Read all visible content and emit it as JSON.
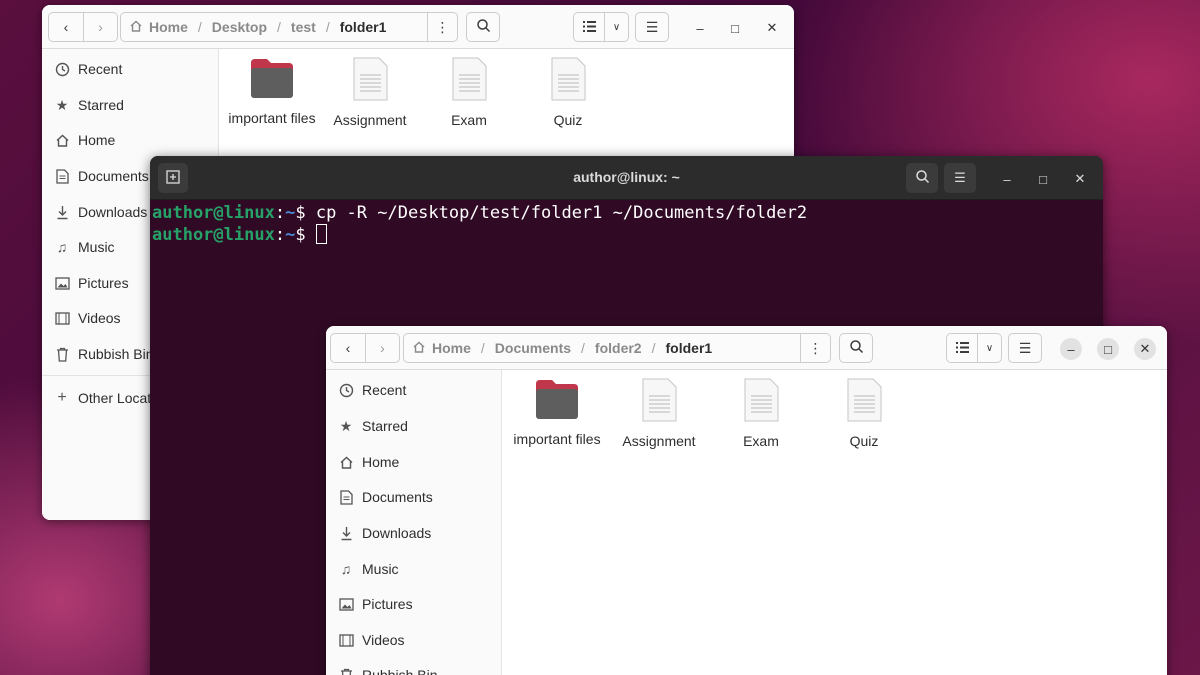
{
  "window1": {
    "path": [
      "Home",
      "Desktop",
      "test",
      "folder1"
    ],
    "sidebar": [
      "Recent",
      "Starred",
      "Home",
      "Documents",
      "Downloads",
      "Music",
      "Pictures",
      "Videos",
      "Rubbish Bin"
    ],
    "other_locations": "Other Locations",
    "files": [
      {
        "name": "important files",
        "type": "folder"
      },
      {
        "name": "Assignment",
        "type": "document"
      },
      {
        "name": "Exam",
        "type": "document"
      },
      {
        "name": "Quiz",
        "type": "document"
      }
    ]
  },
  "terminal": {
    "title": "author@linux: ~",
    "prompt_user": "author@linux",
    "prompt_sep": ":",
    "prompt_path": "~",
    "prompt_symbol": "$",
    "command": "cp -R ~/Desktop/test/folder1 ~/Documents/folder2"
  },
  "window2": {
    "path": [
      "Home",
      "Documents",
      "folder2",
      "folder1"
    ],
    "sidebar": [
      "Recent",
      "Starred",
      "Home",
      "Documents",
      "Downloads",
      "Music",
      "Pictures",
      "Videos",
      "Rubbish Bin"
    ],
    "files": [
      {
        "name": "important files",
        "type": "folder"
      },
      {
        "name": "Assignment",
        "type": "document"
      },
      {
        "name": "Exam",
        "type": "document"
      },
      {
        "name": "Quiz",
        "type": "document"
      }
    ]
  },
  "icons": {
    "home": "home-icon",
    "back": "chevron-left-icon",
    "forward": "chevron-right-icon",
    "search": "search-icon",
    "list_view": "list-view-icon",
    "menu": "hamburger-menu-icon"
  },
  "colors": {
    "desktop_bg": "#43093a",
    "terminal_bg": "#300a24",
    "prompt_user": "#26a269",
    "prompt_path": "#4d8ad8",
    "folder": "#5e5e5e",
    "folder_tab": "#c0364a"
  }
}
